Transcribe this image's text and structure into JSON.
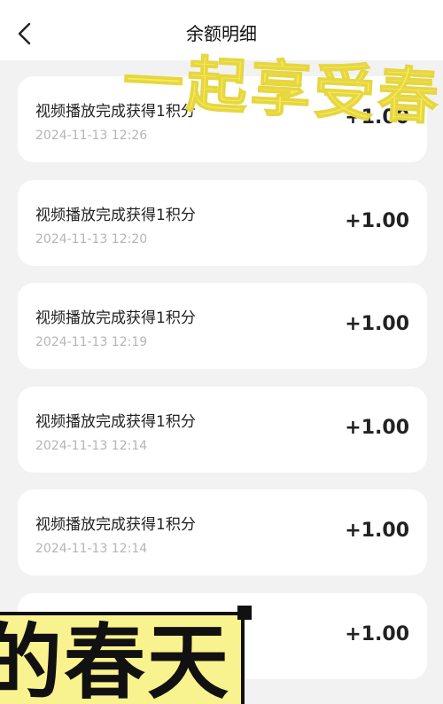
{
  "header": {
    "title": "余额明细",
    "back_icon": "chevron-left-icon"
  },
  "records": [
    {
      "description": "视频播放完成获得1积分",
      "time": "2024-11-13 12:26",
      "amount": "+1.00"
    },
    {
      "description": "视频播放完成获得1积分",
      "time": "2024-11-13 12:20",
      "amount": "+1.00"
    },
    {
      "description": "视频播放完成获得1积分",
      "time": "2024-11-13 12:19",
      "amount": "+1.00"
    },
    {
      "description": "视频播放完成获得1积分",
      "time": "2024-11-13 12:14",
      "amount": "+1.00"
    },
    {
      "description": "视频播放完成获得1积分",
      "time": "2024-11-13 12:14",
      "amount": "+1.00"
    },
    {
      "description": "",
      "time": "",
      "amount": "+1.00"
    }
  ],
  "overlay": {
    "brush_text": "一起享受春",
    "poster_text": "的春天",
    "poster_color": "#f8f38e",
    "brush_color": "#f7ec5a"
  }
}
